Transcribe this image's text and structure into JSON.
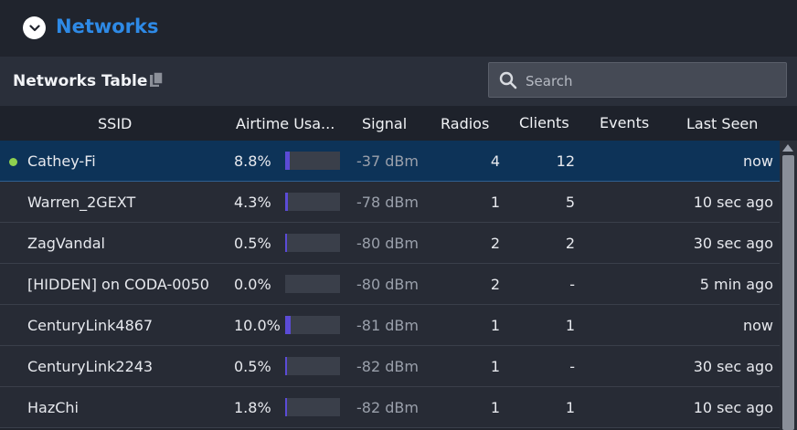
{
  "header": {
    "title": "Networks"
  },
  "table": {
    "title": "Networks Table",
    "search": {
      "placeholder": "Search",
      "value": ""
    },
    "columns": [
      "SSID",
      "Airtime Usa...",
      "Signal",
      "Radios",
      "Clients",
      "Events",
      "Last Seen"
    ],
    "rows": [
      {
        "ssid": "Cathey-Fi",
        "airtime": "8.8%",
        "airtime_fraction": 0.088,
        "signal": "-37 dBm",
        "radios": "4",
        "clients": "12",
        "events": "",
        "last_seen": "now",
        "selected": true
      },
      {
        "ssid": "Warren_2GEXT",
        "airtime": "4.3%",
        "airtime_fraction": 0.043,
        "signal": "-78 dBm",
        "radios": "1",
        "clients": "5",
        "events": "",
        "last_seen": "10 sec ago",
        "selected": false
      },
      {
        "ssid": "ZagVandal",
        "airtime": "0.5%",
        "airtime_fraction": 0.005,
        "signal": "-80 dBm",
        "radios": "2",
        "clients": "2",
        "events": "",
        "last_seen": "30 sec ago",
        "selected": false
      },
      {
        "ssid": "[HIDDEN] on CODA-0050",
        "airtime": "0.0%",
        "airtime_fraction": 0.0,
        "signal": "-80 dBm",
        "radios": "2",
        "clients": "-",
        "events": "",
        "last_seen": "5 min ago",
        "selected": false
      },
      {
        "ssid": "CenturyLink4867",
        "airtime": "10.0%",
        "airtime_fraction": 0.1,
        "signal": "-81 dBm",
        "radios": "1",
        "clients": "1",
        "events": "",
        "last_seen": "now",
        "selected": false
      },
      {
        "ssid": "CenturyLink2243",
        "airtime": "0.5%",
        "airtime_fraction": 0.005,
        "signal": "-82 dBm",
        "radios": "1",
        "clients": "-",
        "events": "",
        "last_seen": "30 sec ago",
        "selected": false
      },
      {
        "ssid": "HazChi",
        "airtime": "1.8%",
        "airtime_fraction": 0.018,
        "signal": "-82 dBm",
        "radios": "1",
        "clients": "1",
        "events": "",
        "last_seen": "10 sec ago",
        "selected": false
      }
    ]
  },
  "colors": {
    "accent": "#2e8ae6",
    "selected_row": "#0d3358",
    "airtime_bar": "#5b4bd6",
    "active_dot": "#8fd14f"
  },
  "icons": [
    "chevron-down-icon",
    "copy-icon",
    "search-icon"
  ]
}
